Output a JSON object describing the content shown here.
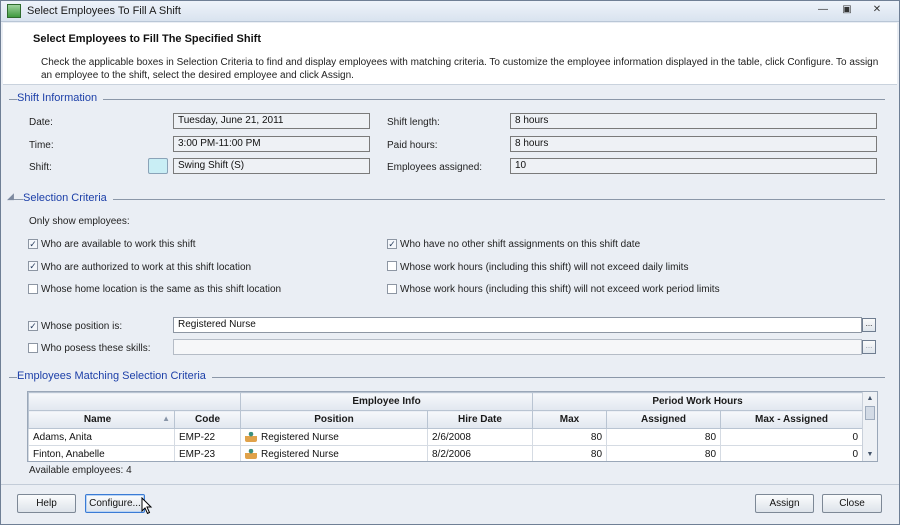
{
  "window": {
    "title": "Select Employees To Fill A Shift",
    "icon": "app-icon",
    "controls": [
      "minimize-icon",
      "restore-icon",
      "close-icon"
    ]
  },
  "header": {
    "title": "Select Employees to Fill The Specified Shift",
    "description": "Check the applicable boxes in Selection Criteria to find and display employees with matching criteria. To customize the employee information displayed in the table, click Configure. To assign an employee to the shift, select the desired employee and click Assign."
  },
  "shift_info": {
    "section_label": "Shift Information",
    "date_label": "Date:",
    "date_value": "Tuesday, June 21, 2011",
    "time_label": "Time:",
    "time_value": "3:00 PM-11:00 PM",
    "shift_label": "Shift:",
    "shift_value": "Swing Shift (S)",
    "shift_color": "#c9eef5",
    "length_label": "Shift length:",
    "length_value": "8 hours",
    "paid_label": "Paid hours:",
    "paid_value": "8 hours",
    "assigned_label": "Employees assigned:",
    "assigned_value": "10"
  },
  "criteria": {
    "section_label": "Selection Criteria",
    "only_show": "Only show employees:",
    "items": [
      {
        "label": "Who are available to work this shift",
        "checked": true
      },
      {
        "label": "Who have no other shift assignments on this shift date",
        "checked": true
      },
      {
        "label": "Who are authorized to  work at this shift location",
        "checked": true
      },
      {
        "label": "Whose work hours (including this shift) will not exceed daily limits",
        "checked": false
      },
      {
        "label": "Whose home location is the same as this shift location",
        "checked": false
      },
      {
        "label": "Whose work hours (including this shift) will not exceed work period limits",
        "checked": false
      }
    ],
    "position": {
      "label": "Whose position is:",
      "checked": true,
      "value": "Registered Nurse"
    },
    "skills": {
      "label": "Who posess these skills:",
      "checked": false,
      "value": ""
    },
    "browse_label": "..."
  },
  "results": {
    "section_label": "Employees Matching Selection Criteria",
    "group_headers": [
      "Employee Info",
      "Period Work Hours"
    ],
    "columns": [
      "Name",
      "Code",
      "Position",
      "Hire Date",
      "Max",
      "Assigned",
      "Max - Assigned"
    ],
    "rows": [
      {
        "name": "Adams, Anita",
        "code": "EMP-22",
        "position": "Registered Nurse",
        "hire_date": "2/6/2008",
        "max": "80",
        "assigned": "80",
        "remaining": "0"
      },
      {
        "name": "Finton, Anabelle",
        "code": "EMP-23",
        "position": "Registered Nurse",
        "hire_date": "8/2/2006",
        "max": "80",
        "assigned": "80",
        "remaining": "0"
      }
    ],
    "available": "Available employees: 4"
  },
  "buttons": {
    "help": "Help",
    "configure": "Configure...",
    "assign": "Assign",
    "close": "Close"
  }
}
